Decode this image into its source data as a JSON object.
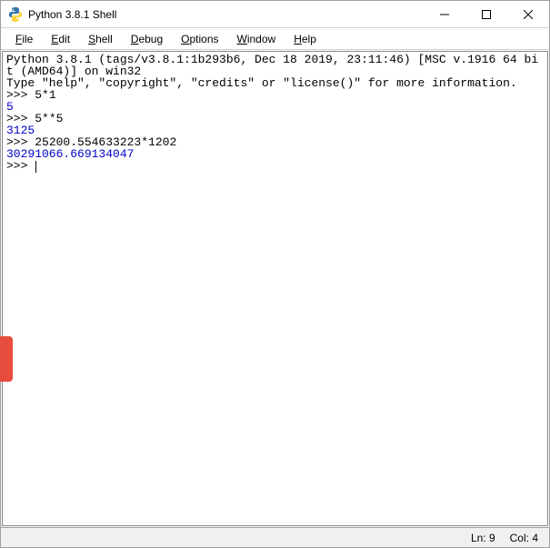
{
  "titlebar": {
    "title": "Python 3.8.1 Shell"
  },
  "menubar": {
    "file": "File",
    "edit": "Edit",
    "shell": "Shell",
    "debug": "Debug",
    "options": "Options",
    "window": "Window",
    "help": "Help"
  },
  "session": {
    "banner1": "Python 3.8.1 (tags/v3.8.1:1b293b6, Dec 18 2019, 23:11:46) [MSC v.1916 64 bit (AMD64)] on win32",
    "banner2": "Type \"help\", \"copyright\", \"credits\" or \"license()\" for more information.",
    "prompt": ">>> ",
    "input1": "5*1",
    "output1": "5",
    "input2": "5**5",
    "output2": "3125",
    "input3": "25200.554633223*1202",
    "output3": "30291066.669134047"
  },
  "statusbar": {
    "ln": "Ln: 9",
    "col": "Col: 4"
  }
}
